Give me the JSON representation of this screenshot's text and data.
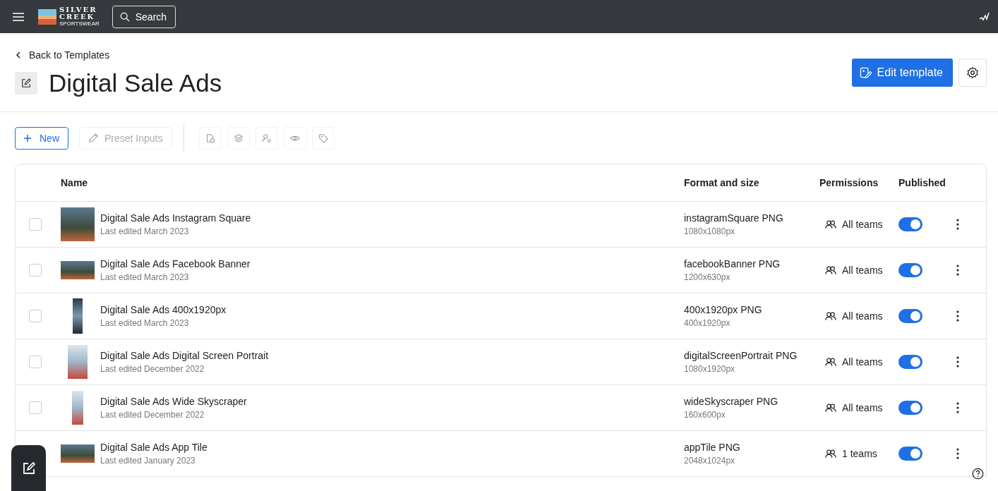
{
  "top_bar": {
    "logo": {
      "line_1": "SILVER",
      "line_2": "CREEK",
      "line_3": "SPORTSWEAR"
    },
    "search_button": "Search"
  },
  "back_link": "Back to Templates",
  "title": "Digital Sale Ads",
  "edit_template_button": "Edit template",
  "toolbar": {
    "new_button": "New",
    "preset_inputs_button": {
      "label": "Preset Inputs",
      "disabled": true
    }
  },
  "table": {
    "columns": [
      "Name",
      "Format and size",
      "Permissions",
      "Published"
    ],
    "rows": [
      {
        "name": "Digital Sale Ads Instagram Square",
        "edited": "Last edited March 2023",
        "format": "instagramSquare PNG",
        "size": "1080x1080px",
        "permissions": "All teams",
        "published": true,
        "checked": false,
        "kind": "square"
      },
      {
        "name": "Digital Sale Ads Facebook Banner",
        "edited": "Last edited March 2023",
        "format": "facebookBanner PNG",
        "size": "1200x630px",
        "permissions": "All teams",
        "published": true,
        "checked": false,
        "kind": "wide"
      },
      {
        "name": "Digital Sale Ads 400x1920px",
        "edited": "Last edited March 2023",
        "format": "400x1920px PNG",
        "size": "400x1920px",
        "permissions": "All teams",
        "published": true,
        "checked": false,
        "kind": "tall"
      },
      {
        "name": "Digital Sale Ads Digital Screen Portrait",
        "edited": "Last edited December 2022",
        "format": "digitalScreenPortrait PNG",
        "size": "1080x1920px",
        "permissions": "All teams",
        "published": true,
        "checked": false,
        "kind": "portrait"
      },
      {
        "name": "Digital Sale Ads Wide Skyscraper",
        "edited": "Last edited December 2022",
        "format": "wideSkyscraper PNG",
        "size": "160x600px",
        "permissions": "All teams",
        "published": true,
        "checked": false,
        "kind": "skyscraper"
      },
      {
        "name": "Digital Sale Ads App Tile",
        "edited": "Last edited January 2023",
        "format": "appTile PNG",
        "size": "2048x1024px",
        "permissions": "1 teams",
        "published": true,
        "kind": "wide"
      }
    ]
  }
}
